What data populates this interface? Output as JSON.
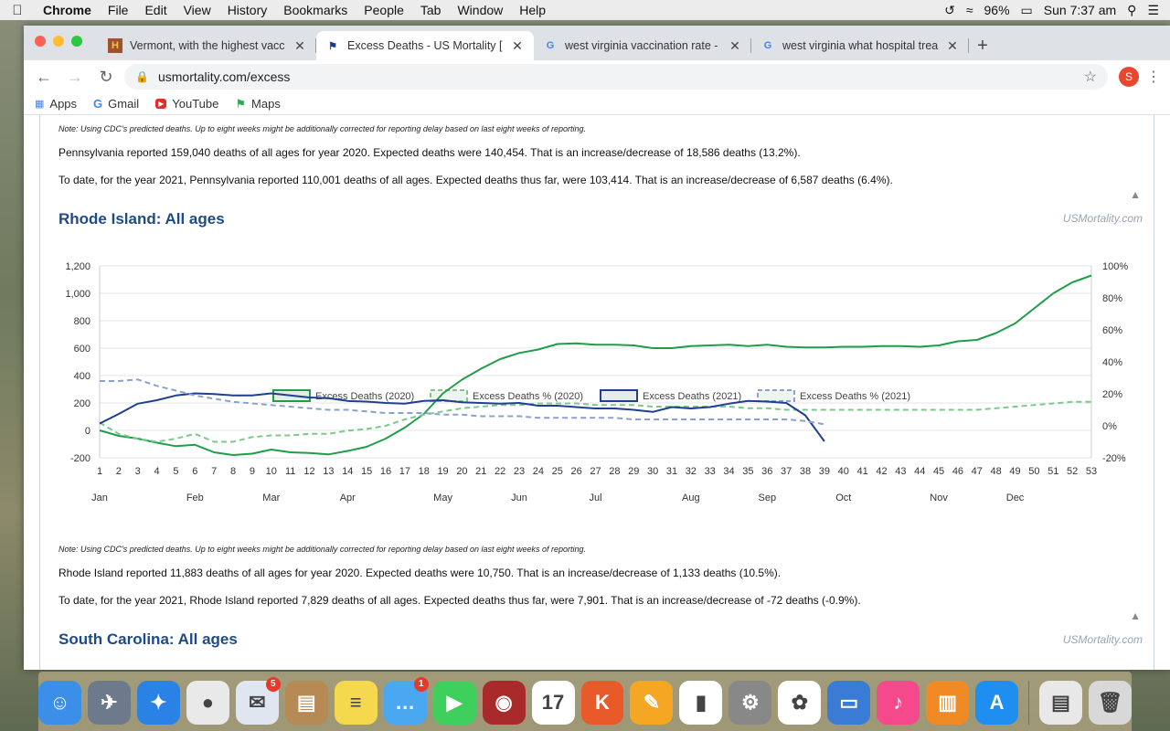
{
  "menubar": {
    "apple": "",
    "items": [
      "Chrome",
      "File",
      "Edit",
      "View",
      "History",
      "Bookmarks",
      "People",
      "Tab",
      "Window",
      "Help"
    ],
    "battery": "96%",
    "clock": "Sun 7:37 am"
  },
  "tabs": [
    {
      "title": "Vermont, with the highest vacc",
      "favicon": "H"
    },
    {
      "title": "Excess Deaths - US Mortality [",
      "favicon": "flag"
    },
    {
      "title": "west virginia vaccination rate -",
      "favicon": "G"
    },
    {
      "title": "west virginia what hospital trea",
      "favicon": "G"
    }
  ],
  "omnibox": {
    "url": "usmortality.com/excess"
  },
  "profile_initial": "S",
  "bookmarks": [
    {
      "label": "Apps"
    },
    {
      "label": "Gmail"
    },
    {
      "label": "YouTube"
    },
    {
      "label": "Maps"
    }
  ],
  "page": {
    "note": "Note: Using CDC's predicted deaths. Up to eight weeks might be additionally corrected for reporting delay based on last eight weeks of reporting.",
    "pa_2020": "Pennsylvania reported 159,040 deaths of all ages for year 2020. Expected deaths were 140,454. That is an increase/decrease of 18,586 deaths (13.2%).",
    "pa_2021": "To date, for the year 2021, Pennsylvania reported 110,001 deaths of all ages. Expected deaths thus far, were 103,414. That is an increase/decrease of 6,587 deaths (6.4%).",
    "ri_heading": "Rhode Island: All ages",
    "brand": "USMortality.com",
    "ri_note": "Note: Using CDC's predicted deaths. Up to eight weeks might be additionally corrected for reporting delay based on last eight weeks of reporting.",
    "ri_2020": "Rhode Island reported 11,883 deaths of all ages for year 2020. Expected deaths were 10,750. That is an increase/decrease of 1,133 deaths (10.5%).",
    "ri_2021": "To date, for the year 2021, Rhode Island reported 7,829 deaths of all ages. Expected deaths thus far, were 7,901. That is an increase/decrease of -72 deaths (-0.9%).",
    "sc_heading": "South Carolina: All ages",
    "brand2": "USMortality.com"
  },
  "chart_data": {
    "type": "line",
    "title": "",
    "x": [
      1,
      2,
      3,
      4,
      5,
      6,
      7,
      8,
      9,
      10,
      11,
      12,
      13,
      14,
      15,
      16,
      17,
      18,
      19,
      20,
      21,
      22,
      23,
      24,
      25,
      26,
      27,
      28,
      29,
      30,
      31,
      32,
      33,
      34,
      35,
      36,
      37,
      38,
      39,
      40,
      41,
      42,
      43,
      44,
      45,
      46,
      47,
      48,
      49,
      50,
      51,
      52,
      53
    ],
    "months": [
      "Jan",
      "Feb",
      "Mar",
      "Apr",
      "May",
      "Jun",
      "Jul",
      "Aug",
      "Sep",
      "Oct",
      "Nov",
      "Dec"
    ],
    "month_weeks": [
      1,
      6,
      10,
      14,
      19,
      23,
      27,
      32,
      36,
      40,
      45,
      49
    ],
    "ylim_left": [
      -200,
      1200
    ],
    "yticks_left": [
      "-200",
      "0",
      "200",
      "400",
      "600",
      "800",
      "1,000",
      "1,200"
    ],
    "ylim_right": [
      -20,
      100
    ],
    "yticks_right": [
      "-20%",
      "0%",
      "20%",
      "40%",
      "60%",
      "80%",
      "100%"
    ],
    "legend_position": "top",
    "series": [
      {
        "name": "Excess Deaths (2020)",
        "axis": "left",
        "color": "#1e9e48",
        "dashed": false,
        "values": [
          0,
          -40,
          -60,
          -90,
          -115,
          -105,
          -160,
          -180,
          -170,
          -140,
          -160,
          -165,
          -175,
          -150,
          -120,
          -60,
          20,
          120,
          270,
          370,
          450,
          520,
          565,
          590,
          630,
          635,
          625,
          625,
          620,
          600,
          600,
          615,
          620,
          625,
          615,
          625,
          610,
          605,
          605,
          610,
          610,
          615,
          615,
          610,
          620,
          650,
          660,
          710,
          780,
          890,
          1000,
          1080,
          1130
        ]
      },
      {
        "name": "Excess Deaths % (2020)",
        "axis": "right",
        "color": "#7cc98a",
        "dashed": true,
        "values": [
          2,
          -5,
          -8,
          -10,
          -8,
          -5,
          -10,
          -10,
          -7,
          -6,
          -6,
          -5,
          -5,
          -3,
          -2,
          0,
          4,
          7,
          9,
          11,
          12,
          13,
          13,
          14,
          14,
          14,
          13,
          13,
          13,
          12,
          12,
          12,
          12,
          12,
          11,
          11,
          10,
          10,
          10,
          10,
          10,
          10,
          10,
          10,
          10,
          10,
          10,
          11,
          12,
          13,
          14,
          15,
          15
        ]
      },
      {
        "name": "Excess Deaths (2021)",
        "axis": "left",
        "color": "#1f3f8f",
        "dashed": false,
        "values": [
          50,
          120,
          195,
          220,
          255,
          270,
          265,
          255,
          255,
          270,
          255,
          240,
          235,
          215,
          210,
          200,
          195,
          215,
          220,
          205,
          200,
          195,
          200,
          180,
          180,
          170,
          160,
          160,
          150,
          135,
          170,
          160,
          170,
          195,
          215,
          210,
          200,
          110,
          -80
        ]
      },
      {
        "name": "Excess Deaths % (2021)",
        "axis": "right",
        "color": "#8aa0cf",
        "dashed": true,
        "values": [
          28,
          28,
          29,
          25,
          22,
          19,
          17,
          15,
          14,
          13,
          12,
          11,
          10,
          10,
          9,
          8,
          8,
          8,
          7,
          7,
          6,
          6,
          6,
          5,
          5,
          5,
          5,
          5,
          4,
          4,
          4,
          4,
          4,
          4,
          4,
          4,
          4,
          3,
          1
        ]
      }
    ]
  },
  "dock": {
    "apps": [
      {
        "name": "finder",
        "color": "#3b8fe8",
        "glyph": "☺"
      },
      {
        "name": "launchpad",
        "color": "#6c7a8c",
        "glyph": "✈"
      },
      {
        "name": "safari",
        "color": "#2a82e4",
        "glyph": "✦"
      },
      {
        "name": "chrome",
        "color": "#e9e9e9",
        "glyph": "●"
      },
      {
        "name": "mail",
        "color": "#dfe6ef",
        "glyph": "✉",
        "badge": "5"
      },
      {
        "name": "contacts",
        "color": "#b58a55",
        "glyph": "▤"
      },
      {
        "name": "notes",
        "color": "#f4d94f",
        "glyph": "≡"
      },
      {
        "name": "messages",
        "color": "#4aa8f0",
        "glyph": "…",
        "badge": "1"
      },
      {
        "name": "facetime",
        "color": "#3ecf5d",
        "glyph": "▶"
      },
      {
        "name": "photo-booth",
        "color": "#a82a2a",
        "glyph": "◉"
      },
      {
        "name": "calendar",
        "color": "#ffffff",
        "glyph": "17"
      },
      {
        "name": "keynote-k",
        "color": "#e85a2a",
        "glyph": "K"
      },
      {
        "name": "pages",
        "color": "#f5a623",
        "glyph": "✎"
      },
      {
        "name": "numbers",
        "color": "#ffffff",
        "glyph": "▮"
      },
      {
        "name": "system-preferences",
        "color": "#888",
        "glyph": "⚙"
      },
      {
        "name": "photos",
        "color": "#ffffff",
        "glyph": "✿"
      },
      {
        "name": "keynote",
        "color": "#3a7bd5",
        "glyph": "▭"
      },
      {
        "name": "itunes",
        "color": "#f44a8c",
        "glyph": "♪"
      },
      {
        "name": "books",
        "color": "#f08a24",
        "glyph": "▥"
      },
      {
        "name": "app-store",
        "color": "#1e8ef0",
        "glyph": "A"
      },
      {
        "name": "preview",
        "color": "#e8e8e8",
        "glyph": "▤"
      },
      {
        "name": "trash",
        "color": "#d8d8d8",
        "glyph": "🗑"
      }
    ]
  }
}
